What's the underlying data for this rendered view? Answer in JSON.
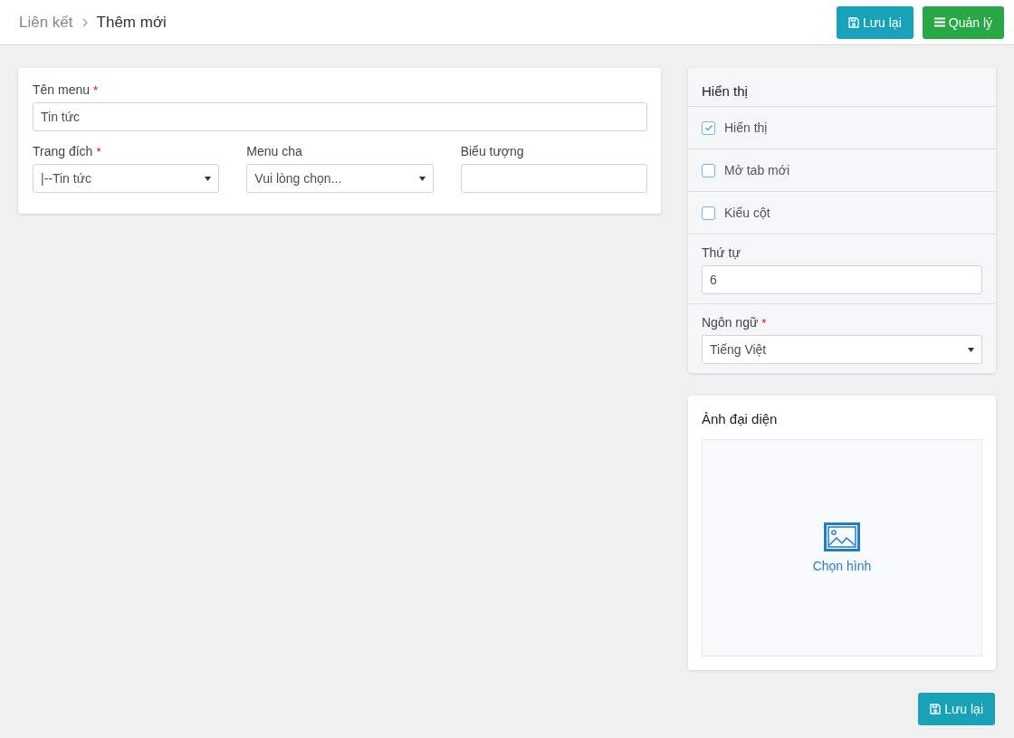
{
  "header": {
    "breadcrumb": [
      "Liên kết",
      "Thêm mới"
    ],
    "buttons": [
      {
        "kind": "save",
        "label": "Lưu lại"
      },
      {
        "kind": "manage",
        "label": "Quản lý"
      }
    ]
  },
  "main_form": {
    "name_field": {
      "label": "Tên menu",
      "required_mark": "*",
      "value": "Tin tức"
    },
    "fields": [
      {
        "kind": "select",
        "label": "Trang đích",
        "required_mark": "*",
        "value": "|--Tin tức"
      },
      {
        "kind": "select",
        "label": "Menu cha",
        "value": "Vui lòng chọn..."
      },
      {
        "kind": "input",
        "label": "Biểu tượng"
      }
    ]
  },
  "display_panel": {
    "title": "Hiển thị",
    "checkboxes": [
      {
        "label": "Hiển thị",
        "checked": true
      },
      {
        "label": "Mở tab mới",
        "checked": false
      },
      {
        "label": "Kiểu cột",
        "checked": false
      }
    ],
    "order": {
      "label": "Thứ tự",
      "value": "6"
    },
    "language": {
      "label": "Ngôn ngữ",
      "required_mark": "*",
      "value": "Tiếng Việt"
    }
  },
  "image_panel": {
    "title": "Ảnh đại diện",
    "pick_label": "Chọn hình"
  },
  "footer": {
    "save_label": "Lưu lại"
  }
}
